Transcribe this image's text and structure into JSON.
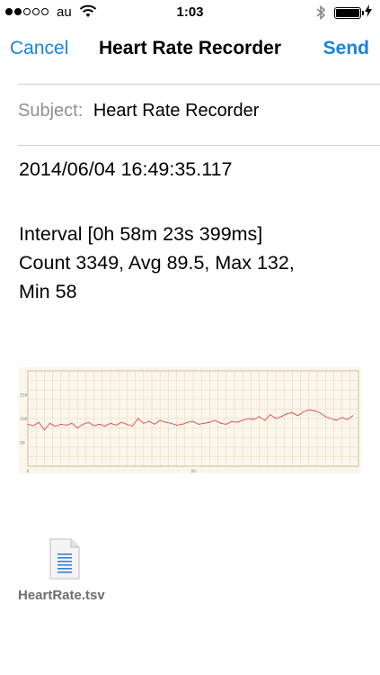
{
  "status_bar": {
    "carrier": "au",
    "time": "1:03",
    "signal_bars_filled": 2,
    "signal_bars_total": 5,
    "icons": [
      "wifi-icon",
      "bluetooth-icon",
      "battery-icon",
      "charging-icon"
    ]
  },
  "nav": {
    "cancel_label": "Cancel",
    "title": "Heart Rate Recorder",
    "send_label": "Send",
    "accent_color": "#1a82e2"
  },
  "subject": {
    "label": "Subject:",
    "value": "Heart Rate Recorder"
  },
  "body": {
    "line1": "2014/06/04 16:49:35.117",
    "line2": "Interval [0h 58m 23s 399ms]",
    "line3": "Count 3349, Avg 89.5, Max 132,",
    "line4": "Min 58"
  },
  "chart_data": {
    "type": "line",
    "title": "",
    "xlabel": "",
    "ylabel": "",
    "y_ticks": [
      "150",
      "100",
      "50"
    ],
    "x_ticks": [
      "0",
      "30"
    ],
    "ylim": [
      0,
      200
    ],
    "xlim": [
      0,
      60
    ],
    "grid": true,
    "line_color": "#e0474c",
    "x": [
      0,
      1,
      2,
      3,
      4,
      5,
      6,
      7,
      8,
      9,
      10,
      11,
      12,
      13,
      14,
      15,
      16,
      17,
      18,
      19,
      20,
      21,
      22,
      23,
      24,
      25,
      26,
      27,
      28,
      29,
      30,
      31,
      32,
      33,
      34,
      35,
      36,
      37,
      38,
      39,
      40,
      41,
      42,
      43,
      44,
      45,
      46,
      47,
      48,
      49,
      50,
      51,
      52,
      53,
      54,
      55,
      56,
      57,
      58,
      59
    ],
    "values": [
      88,
      85,
      92,
      76,
      90,
      84,
      88,
      86,
      90,
      80,
      88,
      92,
      85,
      88,
      84,
      90,
      86,
      92,
      88,
      84,
      100,
      90,
      94,
      88,
      96,
      92,
      90,
      86,
      88,
      92,
      94,
      88,
      90,
      92,
      96,
      90,
      88,
      94,
      92,
      96,
      100,
      98,
      104,
      96,
      108,
      100,
      104,
      110,
      112,
      106,
      114,
      118,
      116,
      112,
      104,
      100,
      96,
      102,
      98,
      106
    ]
  },
  "attachment": {
    "file_name": "HeartRate.tsv",
    "icon": "document-icon"
  }
}
